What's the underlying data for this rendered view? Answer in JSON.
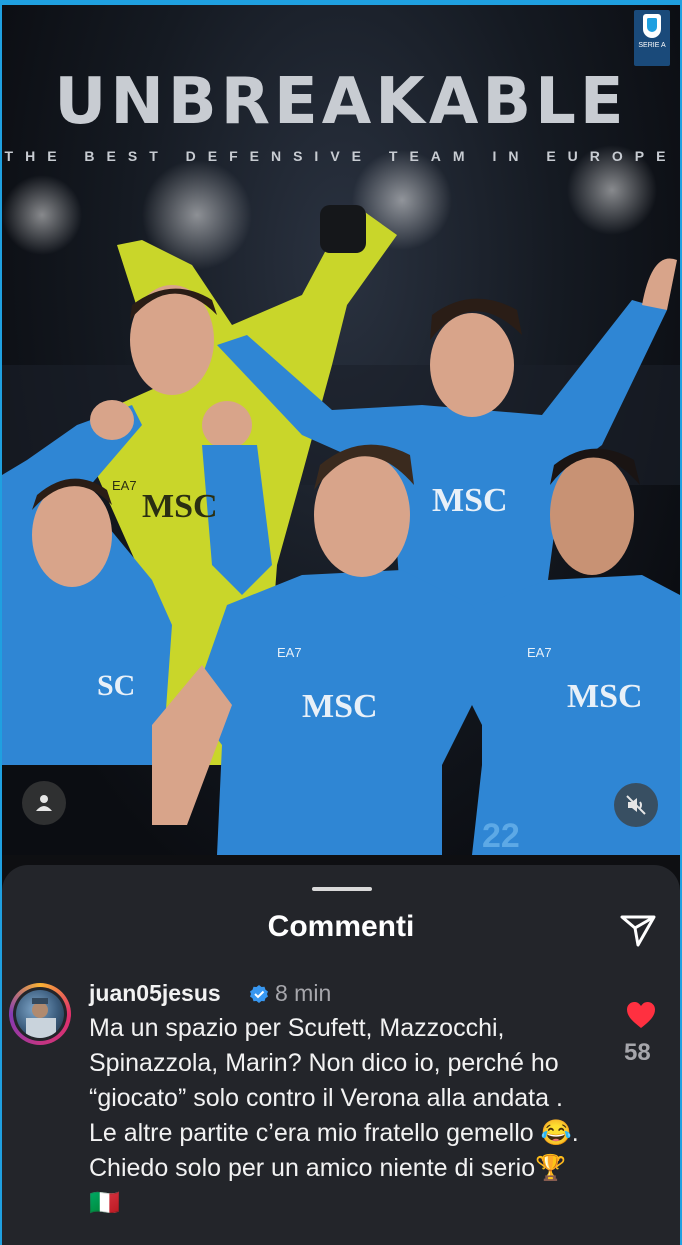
{
  "post": {
    "title": "UNBREAKABLE",
    "subtitle": "THE BEST DEFENSIVE TEAM IN EUROPE",
    "badge_text": "SERIE A",
    "jersey_brand": "MSC",
    "jersey_maker": "EA7",
    "jersey_number": "22",
    "icons": {
      "profile": "person-icon",
      "sound": "mute-icon"
    }
  },
  "comments": {
    "title": "Commenti",
    "send_icon": "send-icon",
    "items": [
      {
        "username": "juan05jesus",
        "verified": true,
        "time": "8 min",
        "text": "Ma un spazio per Scufett, Mazzocchi, Spinazzola, Marin? Non dico io, perché ho “giocato” solo contro il Verona alla andata . Le altre partite c’era mio fratello gemello 😂. Chiedo solo per un amico niente di serio🏆 🇮🇹",
        "likes": "58",
        "liked": true
      }
    ]
  },
  "colors": {
    "accent": "#1fa0e0",
    "sheet_bg": "#23252a",
    "like": "#ff3040",
    "napoli_blue": "#2f86d4",
    "keeper_yellow": "#c9d62a"
  }
}
